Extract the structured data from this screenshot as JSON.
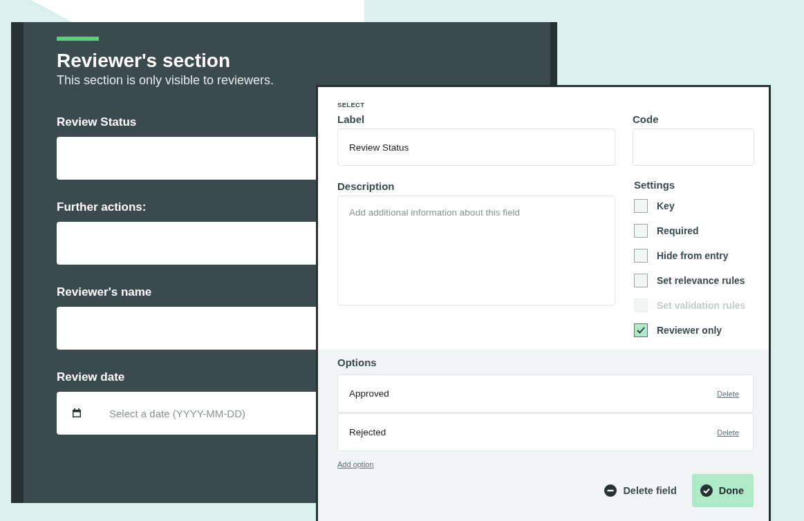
{
  "form": {
    "title": "Reviewer's section",
    "subtitle": "This section is only visible to reviewers.",
    "fields": [
      {
        "label": "Review Status",
        "kind": "text"
      },
      {
        "label": "Further actions:",
        "kind": "text"
      },
      {
        "label": "Reviewer's name",
        "kind": "text"
      },
      {
        "label": "Review date",
        "kind": "date",
        "placeholder": "Select a date (YYYY-MM-DD)"
      }
    ]
  },
  "editor": {
    "type_label": "SELECT",
    "label_field": {
      "label": "Label",
      "value": "Review Status"
    },
    "code_field": {
      "label": "Code"
    },
    "description_field": {
      "label": "Description",
      "placeholder": "Add additional information about this field"
    },
    "settings": {
      "heading": "Settings",
      "items": [
        {
          "label": "Key",
          "checked": false,
          "disabled": false
        },
        {
          "label": "Required",
          "checked": false,
          "disabled": false
        },
        {
          "label": "Hide from entry",
          "checked": false,
          "disabled": false
        },
        {
          "label": "Set relevance rules",
          "checked": false,
          "disabled": false
        },
        {
          "label": "Set validation rules",
          "checked": false,
          "disabled": true
        },
        {
          "label": "Reviewer only",
          "checked": true,
          "disabled": false
        }
      ]
    },
    "options": {
      "heading": "Options",
      "items": [
        {
          "value": "Approved",
          "delete_label": "Delete"
        },
        {
          "value": "Rejected",
          "delete_label": "Delete"
        }
      ],
      "add_label": "Add option"
    },
    "delete_button": {
      "label": "Delete field"
    },
    "done_button": {
      "label": "Done"
    }
  }
}
